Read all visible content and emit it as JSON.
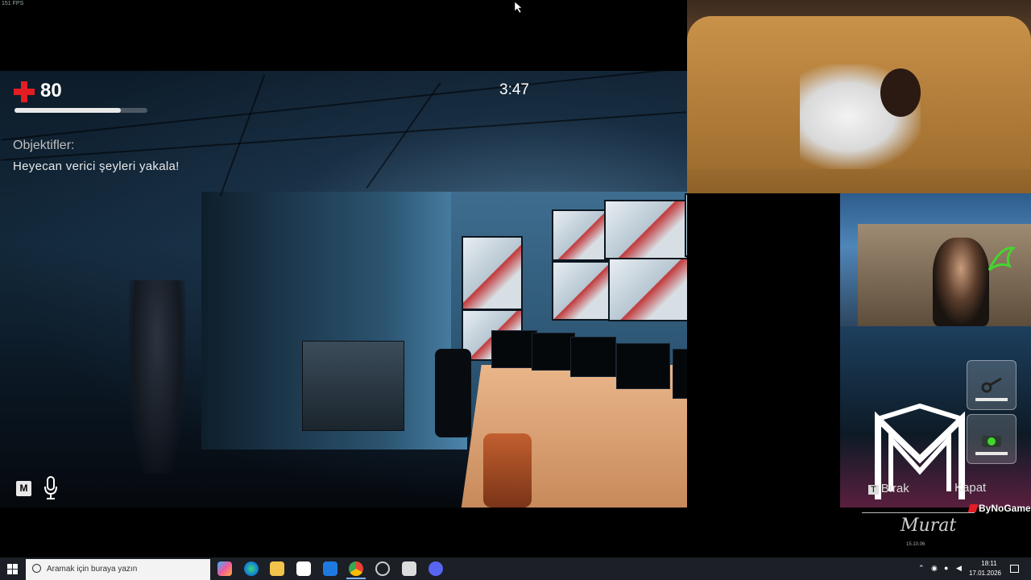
{
  "hud": {
    "fps": "151 FPS",
    "health_value": "80",
    "health_fraction": 0.8,
    "timer": "3:47",
    "objectives_title": "Objektifler:",
    "objective_text": "Heyecan verici şeyleri yakala!",
    "map_key": "M"
  },
  "overlay": {
    "drop_prompt_key": "T",
    "drop_prompt": "Bırak",
    "close_prompt": "Kapat",
    "channel_name": "ByNoGame",
    "signature": "Murat",
    "signature_date": "15.10.06"
  },
  "taskbar": {
    "search_placeholder": "Aramak için buraya yazın",
    "time": "18:11",
    "date": "17.01.2026",
    "apps": [
      "copilot-icon",
      "edge-icon",
      "file-explorer-icon",
      "store-icon",
      "mail-icon",
      "chrome-icon",
      "settings-icon",
      "app-icon",
      "discord-icon"
    ]
  },
  "colors": {
    "health_red": "#e41c24",
    "taskbar_bg": "#1c1f26",
    "active_app_underline": "#7db2ff"
  }
}
